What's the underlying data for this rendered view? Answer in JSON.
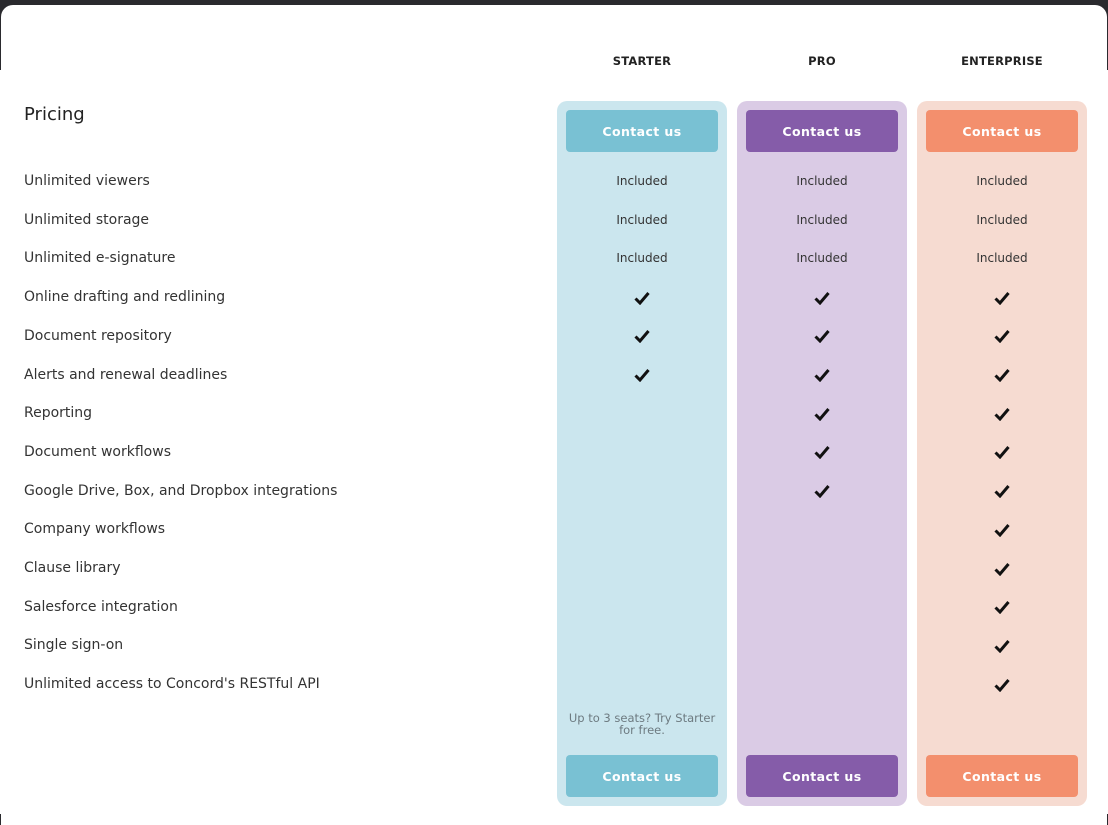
{
  "title": "Pricing",
  "plans": [
    {
      "name": "STARTER",
      "cta": "Contact us",
      "bg": "#cbe6ee",
      "accent": "#79c1d3",
      "available_count": 6,
      "note": "Up to 3 seats? Try Starter for free."
    },
    {
      "name": "PRO",
      "cta": "Contact us",
      "bg": "#dacbe5",
      "accent": "#855ca9",
      "available_count": 9
    },
    {
      "name": "ENTERPRISE",
      "cta": "Contact us",
      "bg": "#f6dbd1",
      "accent": "#f38f6d",
      "available_count": 14
    }
  ],
  "included_label": "Included",
  "features": [
    {
      "label": "Unlimited viewers",
      "display": "text"
    },
    {
      "label": "Unlimited storage",
      "display": "text"
    },
    {
      "label": "Unlimited e-signature",
      "display": "text"
    },
    {
      "label": "Online drafting and redlining",
      "display": "check"
    },
    {
      "label": "Document repository",
      "display": "check"
    },
    {
      "label": "Alerts and renewal deadlines",
      "display": "check"
    },
    {
      "label": "Reporting",
      "display": "check"
    },
    {
      "label": "Document workflows",
      "display": "check"
    },
    {
      "label": "Google Drive, Box, and Dropbox integrations",
      "display": "check"
    },
    {
      "label": "Company workflows",
      "display": "check"
    },
    {
      "label": "Clause library",
      "display": "check"
    },
    {
      "label": "Salesforce integration",
      "display": "check"
    },
    {
      "label": "Single sign-on",
      "display": "check"
    },
    {
      "label": "Unlimited access to Concord's RESTful API",
      "display": "check"
    }
  ]
}
